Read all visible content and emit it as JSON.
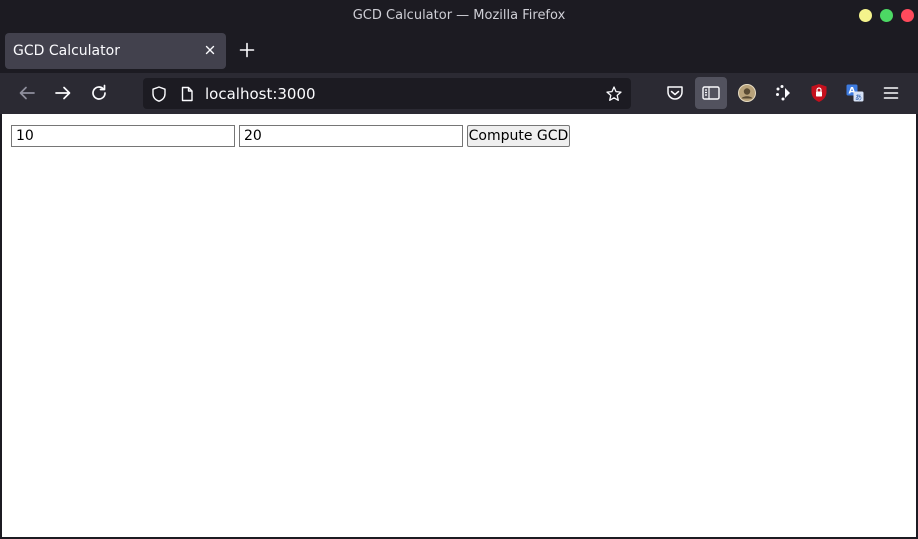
{
  "window": {
    "title": "GCD Calculator — Mozilla Firefox"
  },
  "tabs": [
    {
      "label": "GCD Calculator",
      "active": true
    }
  ],
  "urlbar": {
    "url": "localhost:3000"
  },
  "toolbar": {
    "icons": [
      "back-icon",
      "forward-icon",
      "reload-icon",
      "pocket-icon",
      "sidebar-icon",
      "account-icon",
      "extensions-icon",
      "ublock-icon",
      "translate-icon",
      "menu-icon"
    ]
  },
  "form": {
    "first_value": "10",
    "second_value": "20",
    "compute_label": "Compute GCD"
  },
  "colors": {
    "chrome_dark": "#1c1b22",
    "toolbar": "#2b2a33",
    "tab_active": "#42414d",
    "text_light": "#fbfbfe"
  }
}
